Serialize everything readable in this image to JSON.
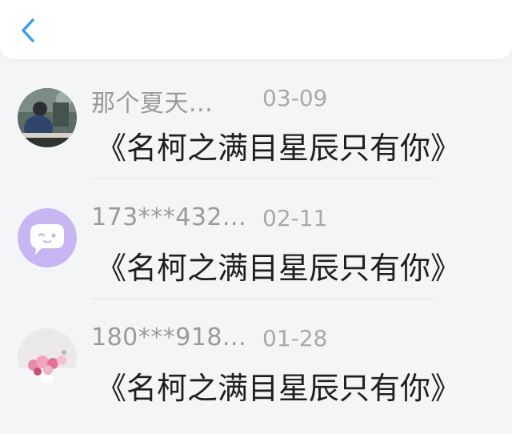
{
  "header": {
    "back_icon": "chevron-left-icon",
    "accent_color": "#3a9ee8"
  },
  "comments": [
    {
      "name": "那个夏天...",
      "date": "03-09",
      "title": "《名柯之满目星辰只有你》",
      "avatar": "photo-avatar-person"
    },
    {
      "name": "173***432...",
      "date": "02-11",
      "title": "《名柯之满目星辰只有你》",
      "avatar": "default-chat-bubble-avatar"
    },
    {
      "name": "180***918...",
      "date": "01-28",
      "title": "《名柯之满目星辰只有你》",
      "avatar": "photo-avatar-flowers"
    }
  ]
}
